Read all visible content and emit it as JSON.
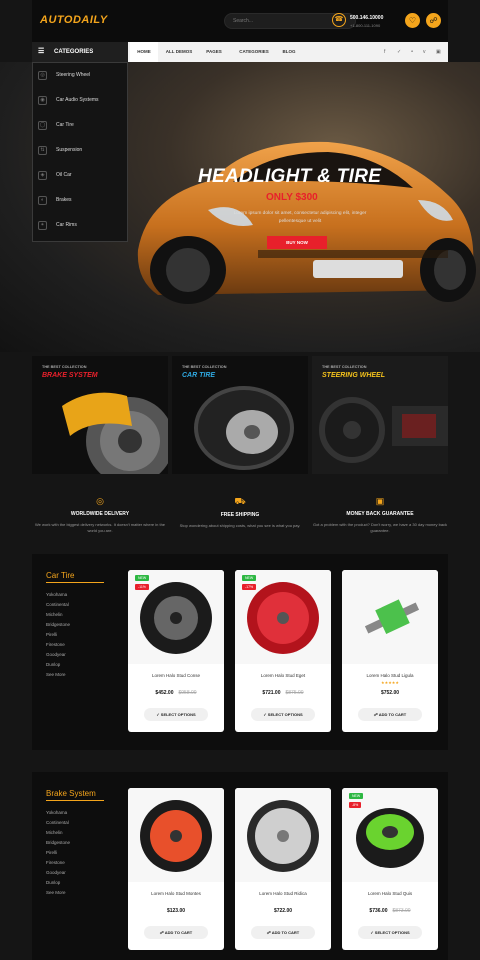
{
  "brand": {
    "logo": "AUTODAILY"
  },
  "header": {
    "search_placeholder": "Search...",
    "phone": "500.146.10000",
    "phone_sub": "+1-800-111-1090"
  },
  "nav": {
    "categories_label": "CATEGORIES",
    "links": [
      "HOME",
      "ALL DEMOS",
      "PAGES",
      "CATEGORIES",
      "BLOG"
    ]
  },
  "category_menu": [
    "Steering Wheel",
    "Car Audio Systems",
    "Car Tire",
    "Suspension",
    "Oil Car",
    "Brakes",
    "Car Rims"
  ],
  "hero": {
    "title": "HEADLIGHT & TIRE",
    "subtitle": "ONLY $300",
    "desc": "Lorem ipsum dolor sit amet, consectetur adipiscing elit, integer pellentesque ut velit",
    "button": "BUY NOW"
  },
  "banners": [
    {
      "pre": "THE BEST COLLECTION",
      "title": "BRAKE SYSTEM",
      "color": "#e8202b"
    },
    {
      "pre": "THE BEST COLLECTION",
      "title": "CAR TIRE",
      "color": "#2fa8e0"
    },
    {
      "pre": "THE BEST COLLECTION",
      "title": "STEERING WHEEL",
      "color": "#f4c21c"
    }
  ],
  "features": [
    {
      "title": "WORLDWIDE DELIVERY",
      "text": "We work with the biggest delivery networks. It doesn't matter where in the world you are."
    },
    {
      "title": "FREE SHIPPING",
      "text": "Stop wondering about shipping costs, what you see is what you pay."
    },
    {
      "title": "MONEY BACK GUARANTEE",
      "text": "Got a problem with the product? Don't worry, we have a 30 day money back guarantee."
    }
  ],
  "sections": [
    {
      "title": "Car Tire",
      "brands": [
        "Yokohama",
        "Continental",
        "Michelin",
        "Bridgestone",
        "Pirelli",
        "Firestone",
        "Goodyear",
        "Dunlop",
        "See More"
      ],
      "products": [
        {
          "name": "Lorem Halo Stud Conse",
          "price": "$452.00",
          "old": "$958.00",
          "button": "SELECT OPTIONS",
          "badges": [
            "NEW",
            "-11%"
          ]
        },
        {
          "name": "Lorem Halo Stud Eget",
          "price": "$721.00",
          "old": "$875.00",
          "button": "SELECT OPTIONS",
          "badges": [
            "NEW",
            "-17%"
          ]
        },
        {
          "name": "Lorem Halo Stud Ligula",
          "price": "$752.00",
          "old": "",
          "stars": "★★★★★",
          "button": "ADD TO CART",
          "badges": []
        }
      ]
    },
    {
      "title": "Brake System",
      "brands": [
        "Yokohama",
        "Continental",
        "Michelin",
        "Bridgestone",
        "Pirelli",
        "Firestone",
        "Goodyear",
        "Dunlop",
        "See More"
      ],
      "products": [
        {
          "name": "Lorem Halo Stud Montes",
          "price": "$123.00",
          "old": "",
          "button": "ADD TO CART",
          "badges": []
        },
        {
          "name": "Lorem Halo Stud Ridica",
          "price": "$722.00",
          "old": "",
          "button": "ADD TO CART",
          "badges": []
        },
        {
          "name": "Lorem Halo Stud Quis",
          "price": "$736.00",
          "old": "$873.00",
          "button": "SELECT OPTIONS",
          "badges": [
            "NEW",
            "-8%"
          ]
        }
      ]
    }
  ],
  "colors": {
    "accent": "#f4a51c",
    "sale": "#e8202b",
    "new": "#2db742"
  }
}
